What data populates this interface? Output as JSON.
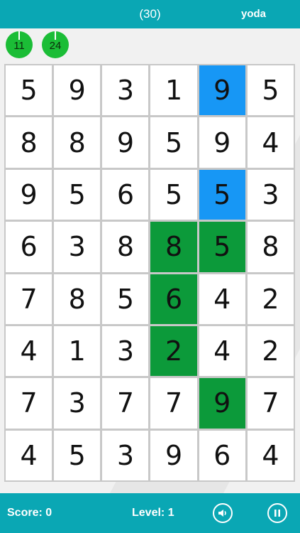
{
  "header": {
    "moves_label": "(30)",
    "username": "yoda"
  },
  "timers": [
    {
      "value": "11"
    },
    {
      "value": "24"
    }
  ],
  "board": {
    "rows": [
      [
        "5",
        "9",
        "3",
        "1",
        "9",
        "5"
      ],
      [
        "8",
        "8",
        "9",
        "5",
        "9",
        "4"
      ],
      [
        "9",
        "5",
        "6",
        "5",
        "5",
        "3"
      ],
      [
        "6",
        "3",
        "8",
        "8",
        "5",
        "8"
      ],
      [
        "7",
        "8",
        "5",
        "6",
        "4",
        "2"
      ],
      [
        "4",
        "1",
        "3",
        "2",
        "4",
        "2"
      ],
      [
        "7",
        "3",
        "7",
        "7",
        "9",
        "7"
      ],
      [
        "4",
        "5",
        "3",
        "9",
        "6",
        "4"
      ]
    ],
    "highlights": {
      "blue": [
        [
          0,
          4
        ],
        [
          2,
          4
        ]
      ],
      "green": [
        [
          3,
          3
        ],
        [
          3,
          4
        ],
        [
          4,
          3
        ],
        [
          5,
          3
        ],
        [
          6,
          4
        ]
      ]
    }
  },
  "footer": {
    "score_label": "Score: 0",
    "level_label": "Level: 1",
    "sound_icon": "speaker-icon",
    "pause_icon": "pause-icon"
  },
  "colors": {
    "bar": "#0aa7b4",
    "blue_cell": "#1797f5",
    "green_cell": "#0c9a3a",
    "timer_bubble": "#1bbd36"
  }
}
